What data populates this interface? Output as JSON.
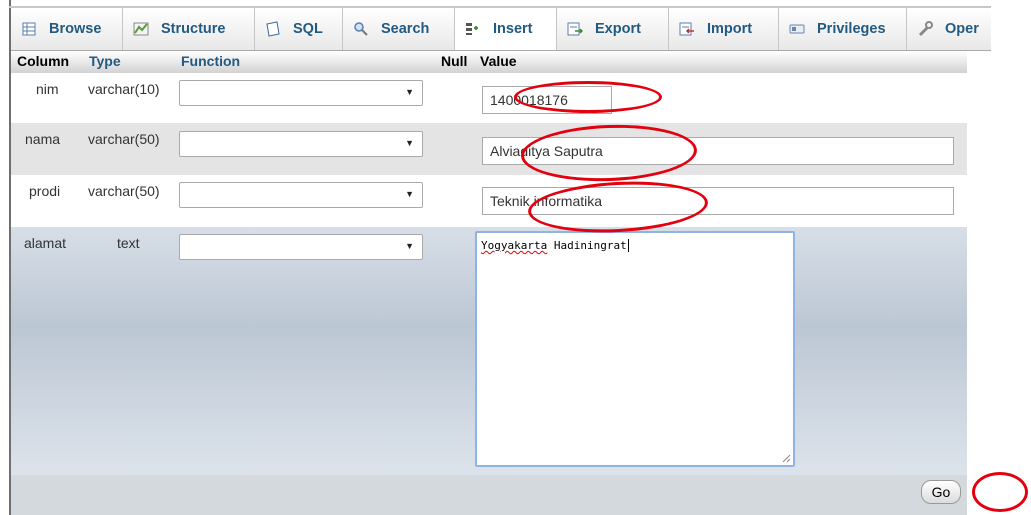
{
  "tabs": [
    {
      "label": "Browse",
      "icon": "table-icon"
    },
    {
      "label": "Structure",
      "icon": "structure-icon"
    },
    {
      "label": "SQL",
      "icon": "sql-icon"
    },
    {
      "label": "Search",
      "icon": "magnifier-icon"
    },
    {
      "label": "Insert",
      "icon": "insert-icon",
      "active": true
    },
    {
      "label": "Export",
      "icon": "export-icon"
    },
    {
      "label": "Import",
      "icon": "import-icon"
    },
    {
      "label": "Privileges",
      "icon": "privileges-icon"
    },
    {
      "label": "Oper",
      "icon": "wrench-icon"
    }
  ],
  "header": {
    "column": "Column",
    "type": "Type",
    "function": "Function",
    "null": "Null",
    "value": "Value"
  },
  "rows": [
    {
      "name": "nim",
      "type": "varchar(10)",
      "function": "",
      "value": "1400018176"
    },
    {
      "name": "nama",
      "type": "varchar(50)",
      "function": "",
      "value": "Alviaditya Saputra"
    },
    {
      "name": "prodi",
      "type": "varchar(50)",
      "function": "",
      "value": "Teknik informatika"
    },
    {
      "name": "alamat",
      "type": "text",
      "function": "",
      "value_word1": "Yogyakarta",
      "value_word2": " Hadiningrat"
    }
  ],
  "footer": {
    "go_label": "Go"
  },
  "colors": {
    "tab_text": "#235a81",
    "annotation_red": "#e3000f",
    "textarea_focus": "#8fb4e3"
  }
}
